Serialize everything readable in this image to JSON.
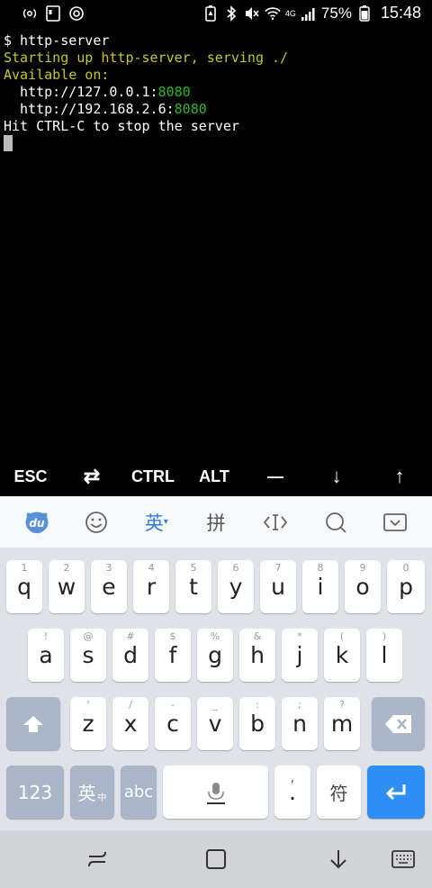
{
  "statusbar": {
    "battery_percent": "75%",
    "time": "15:48",
    "network": "4G"
  },
  "terminal": {
    "lines": [
      {
        "text": "$ http-server",
        "suffix": ""
      },
      {
        "text": "Starting up http-server, serving ./",
        "suffix": ""
      },
      {
        "text": "Available on:",
        "suffix": ""
      },
      {
        "text": "  http://127.0.0.1:",
        "suffix": "8080"
      },
      {
        "text": "  http://192.168.2.6:",
        "suffix": "8080"
      },
      {
        "text": "Hit CTRL-C to stop the server",
        "suffix": ""
      }
    ]
  },
  "extra_keys": {
    "esc": "ESC",
    "tab": "⇄",
    "ctrl": "CTRL",
    "alt": "ALT",
    "dash": "—",
    "down": "↓",
    "up": "↑"
  },
  "toolbar": {
    "logo": "du",
    "english": "英",
    "pinyin": "拼"
  },
  "keyboard": {
    "row1": [
      {
        "key": "q",
        "hint": "1"
      },
      {
        "key": "w",
        "hint": "2"
      },
      {
        "key": "e",
        "hint": "3"
      },
      {
        "key": "r",
        "hint": "4"
      },
      {
        "key": "t",
        "hint": "5"
      },
      {
        "key": "y",
        "hint": "6"
      },
      {
        "key": "u",
        "hint": "7"
      },
      {
        "key": "i",
        "hint": "8"
      },
      {
        "key": "o",
        "hint": "9"
      },
      {
        "key": "p",
        "hint": "0"
      }
    ],
    "row2": [
      {
        "key": "a",
        "hint": "!"
      },
      {
        "key": "s",
        "hint": "@"
      },
      {
        "key": "d",
        "hint": "#"
      },
      {
        "key": "f",
        "hint": "$"
      },
      {
        "key": "g",
        "hint": "%"
      },
      {
        "key": "h",
        "hint": "&"
      },
      {
        "key": "j",
        "hint": "*"
      },
      {
        "key": "k",
        "hint": "("
      },
      {
        "key": "l",
        "hint": ")"
      }
    ],
    "row3": [
      {
        "key": "z",
        "hint": "'"
      },
      {
        "key": "x",
        "hint": "/"
      },
      {
        "key": "c",
        "hint": "-"
      },
      {
        "key": "v",
        "hint": "_"
      },
      {
        "key": "b",
        "hint": ":"
      },
      {
        "key": "n",
        "hint": ";"
      },
      {
        "key": "m",
        "hint": "?"
      }
    ],
    "numbers_label": "123",
    "lang_label": "英",
    "lang_sub": "中",
    "abc_label": "abc",
    "comma_label": ",",
    "period_label": ".",
    "symbol_label": "符"
  }
}
